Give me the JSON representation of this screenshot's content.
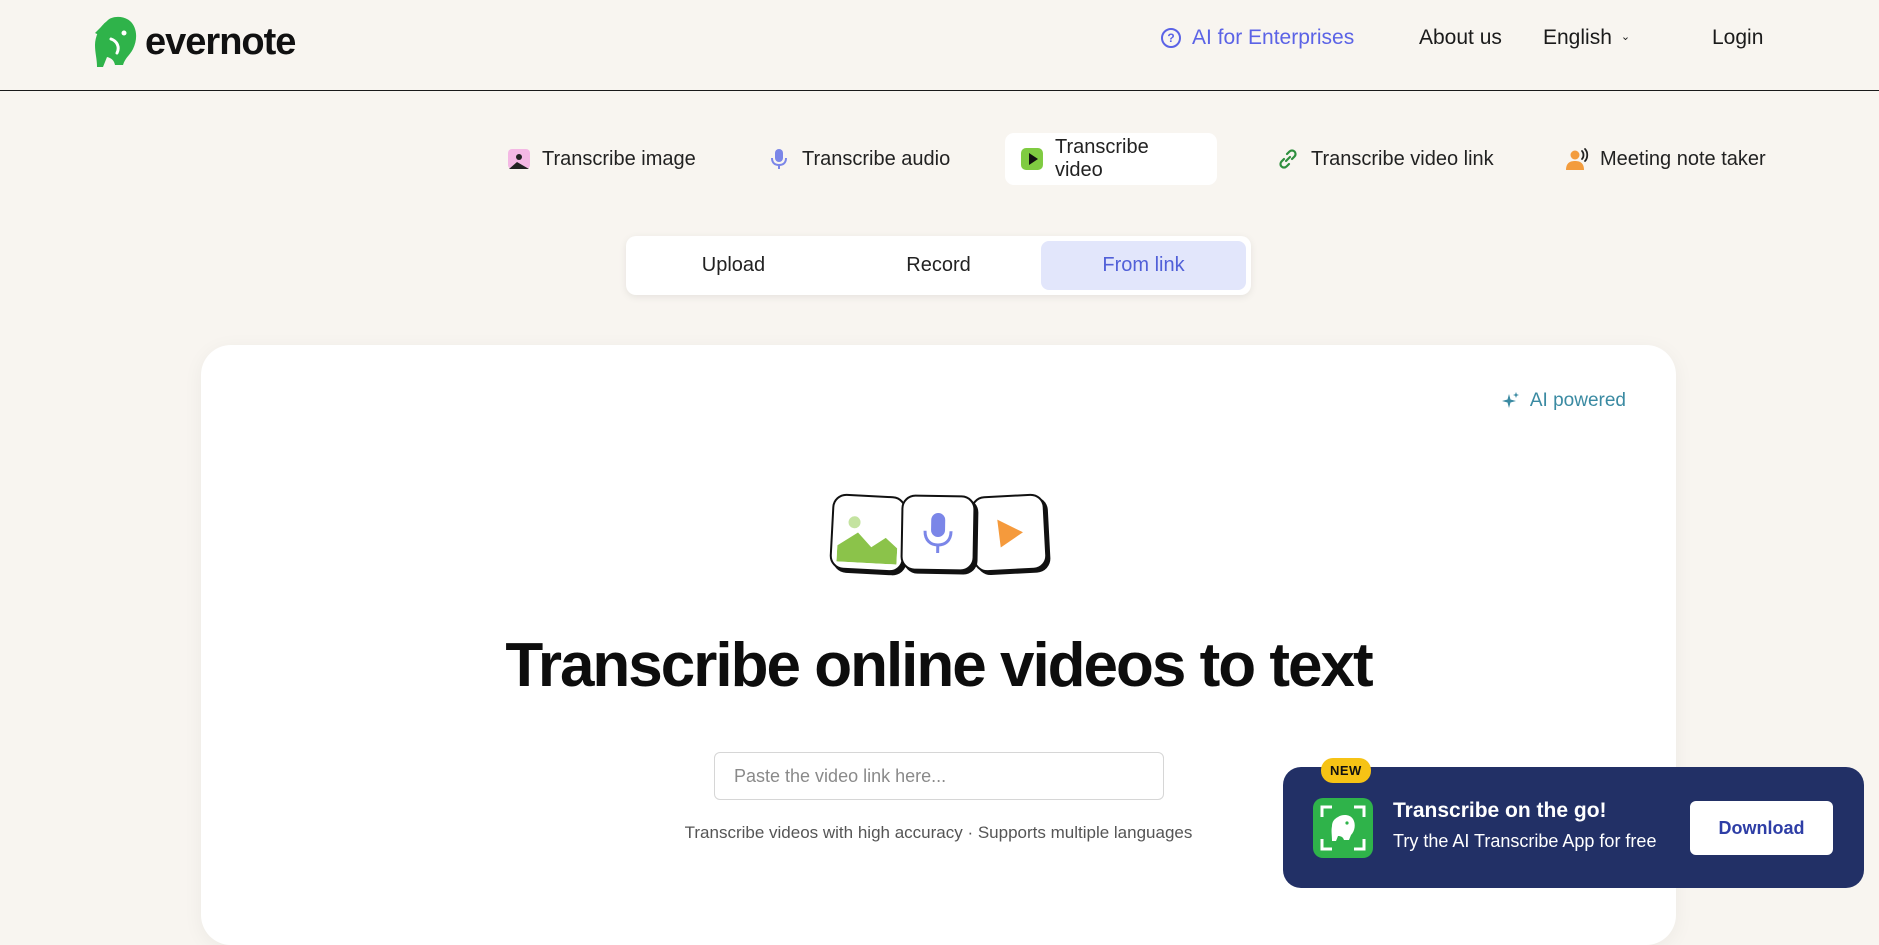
{
  "header": {
    "logo_text": "evernote",
    "nav": {
      "ai_enterprises": "AI for Enterprises",
      "about": "About us",
      "language": "English",
      "login": "Login"
    }
  },
  "product_tabs": [
    {
      "label": "Transcribe image",
      "icon": "image-icon",
      "active": false
    },
    {
      "label": "Transcribe audio",
      "icon": "microphone-icon",
      "active": false
    },
    {
      "label": "Transcribe video",
      "icon": "video-play-icon",
      "active": true
    },
    {
      "label": "Transcribe video link",
      "icon": "link-icon",
      "active": false
    },
    {
      "label": "Meeting note taker",
      "icon": "speaker-person-icon",
      "active": false
    }
  ],
  "source_tabs": [
    {
      "label": "Upload",
      "active": false
    },
    {
      "label": "Record",
      "active": false
    },
    {
      "label": "From link",
      "active": true
    }
  ],
  "card": {
    "ai_badge": "AI powered",
    "hero_title": "Transcribe online videos to text",
    "link_input": {
      "placeholder": "Paste the video link here...",
      "value": ""
    },
    "subtext": "Transcribe videos with high accuracy · Supports multiple languages"
  },
  "promo": {
    "badge": "NEW",
    "title": "Transcribe on the go!",
    "subtitle": "Try the AI Transcribe App for free",
    "button": "Download"
  },
  "colors": {
    "background": "#f8f5f0",
    "brand_green": "#2fb34a",
    "accent_blue": "#5b63e6",
    "promo_navy": "#223066"
  }
}
